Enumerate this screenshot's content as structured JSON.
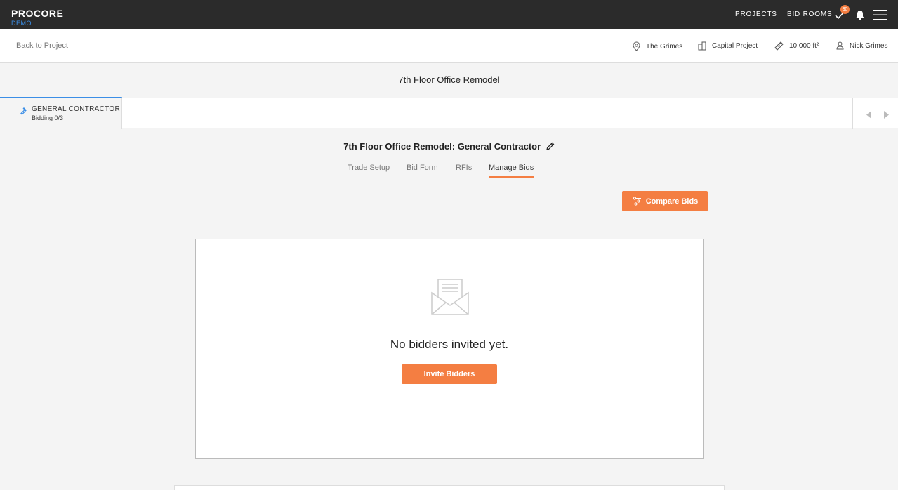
{
  "topbar": {
    "logo": "PROCORE",
    "logo_sub": "DEMO",
    "nav": [
      "PROJECTS",
      "BID ROOMS"
    ],
    "task_count": "30",
    "icons": [
      "check-icon",
      "bell-icon",
      "hamburger-menu-icon"
    ]
  },
  "project_bar": {
    "back_label": "Back to Project",
    "location": "The Grimes",
    "project_type": "Capital Project",
    "area": "10,000 ft²",
    "user": "Nick Grimes"
  },
  "project_title": "7th Floor Office Remodel",
  "trade": {
    "name": "GENERAL CONTRACTOR",
    "status": "Bidding 0/3"
  },
  "heading": "7th Floor Office Remodel: General Contractor",
  "tabs": [
    {
      "label": "Trade Setup",
      "active": false
    },
    {
      "label": "Bid Form",
      "active": false
    },
    {
      "label": "RFIs",
      "active": false
    },
    {
      "label": "Manage Bids",
      "active": true
    }
  ],
  "compare_label": "Compare Bids",
  "empty_state": {
    "message": "No bidders invited yet.",
    "button": "Invite Bidders"
  },
  "colors": {
    "accent": "#f47e42",
    "topbar": "#2b2b2b",
    "link_blue": "#3b8ee6"
  }
}
